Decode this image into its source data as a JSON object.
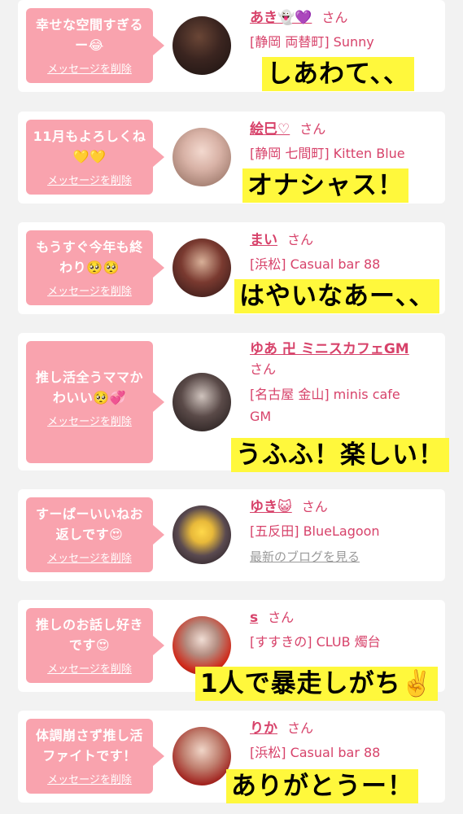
{
  "common": {
    "delete_label": "メッセージを削除",
    "honorific": "さん",
    "blog_link": "最新のブログを見る"
  },
  "cards": [
    {
      "message_lines": [
        "幸せな空間すぎる",
        "ー😂"
      ],
      "name": "あき👻💜",
      "shop": "[静岡 両替町] Sunny",
      "caption": "しあわて、、"
    },
    {
      "message_lines": [
        "11月もよろしくね",
        "💛💛"
      ],
      "name": "絵巳♡",
      "shop": "[静岡 七間町] Kitten Blue",
      "caption": "オナシャス！"
    },
    {
      "message_lines": [
        "もうすぐ今年も終",
        "わり🥺🥺"
      ],
      "name": "まい",
      "shop": "[浜松] Casual bar 88",
      "caption": "はやいなあー、、"
    },
    {
      "message_lines": [
        "推し活全うママか",
        "わいい🥺💞"
      ],
      "name": "ゆあ 卍 ミニスカフェGM",
      "shop_lines": [
        "[名古屋 金山] minis cafe",
        "GM"
      ],
      "caption": "うふふ！楽しい！"
    },
    {
      "message_lines": [
        "すーぱーいいねお",
        "返しです😍"
      ],
      "name": "ゆき😺",
      "shop": "[五反田] BlueLagoon"
    },
    {
      "message_lines": [
        "推しのお話し好き",
        "です😍"
      ],
      "name": "s",
      "shop": "[すすきの] CLUB 燭台",
      "caption": "1人で暴走しがち✌️"
    },
    {
      "message_lines": [
        "体調崩さず推し活",
        "ファイトです！"
      ],
      "name": "りか",
      "shop": "[浜松] Casual bar 88",
      "caption": "ありがとうー！"
    }
  ],
  "colors": {
    "bubble": "#f9a3ae",
    "accent": "#d7426a",
    "caption_bg": "#fff83c",
    "page_bg": "#f2f2f2"
  }
}
